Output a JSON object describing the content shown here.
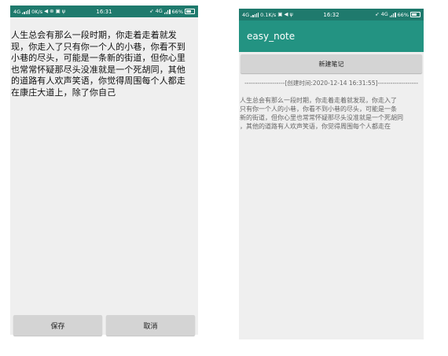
{
  "edit_screen": {
    "status": {
      "network": "4G",
      "speed": "0K/s",
      "time": "16:31",
      "net_type": "4G",
      "battery": "66%"
    },
    "content_lines": [
      "人生总会有那么一段时期，你走着走着就发",
      "现，你走入了只有你一个人的小巷，你看不到",
      "小巷的尽头，可能是一条新的街道，但你心里",
      "也常常怀疑那尽头没准就是一个死胡同，其他",
      "的道路有人欢声笑语，你觉得周围每个人都走",
      "在康庄大道上，除了你自己"
    ],
    "save_label": "保存",
    "cancel_label": "取消"
  },
  "list_screen": {
    "status": {
      "network": "4G",
      "speed": "0.1K/s",
      "time": "16:32",
      "net_type": "4G",
      "battery": "66%"
    },
    "app_title": "easy_note",
    "new_note_label": "新建笔记",
    "note_header": "-------------------[创建时间:2020-12-14 16:31:55]-------------------",
    "note_lines": [
      "人生总会有那么一段时期，你走着走着就发现，你走入了",
      "只有你一个人的小巷，你看不到小巷的尽头，可能是一条",
      "新的街道，但你心里也常常怀疑那尽头没准就是一个死胡同",
      "，其他的道路有人欢声笑语，你觉得周围每个人都走在"
    ]
  }
}
